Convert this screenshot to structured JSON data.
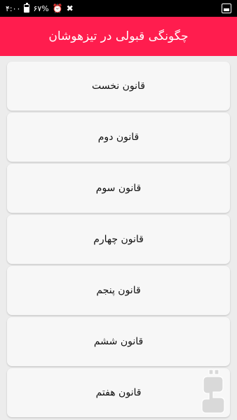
{
  "status": {
    "time": "۴:۰۰",
    "battery": "۶۷%",
    "icons": [
      "alarm-icon",
      "mute-icon",
      "battery-icon",
      "image-notification-icon"
    ]
  },
  "appbar": {
    "title": "چگونگی قبولی در تیزهوشان",
    "color": "#ff1d4e"
  },
  "items": [
    {
      "label": "قانون نخست"
    },
    {
      "label": "قانون دوم"
    },
    {
      "label": "قانون سوم"
    },
    {
      "label": "قانون چهارم"
    },
    {
      "label": "قانون پنجم"
    },
    {
      "label": "قانون ششم"
    },
    {
      "label": "قانون هفتم"
    }
  ],
  "watermark": {
    "brand": "بازار"
  }
}
